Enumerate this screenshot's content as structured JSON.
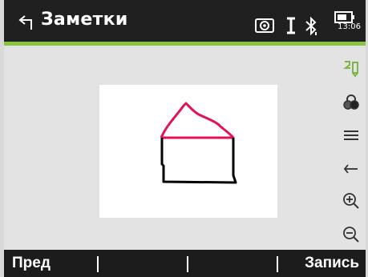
{
  "header": {
    "title": "Заметки",
    "time": "13:06",
    "accent_color": "#8ac43f",
    "status_icons": [
      "target-prism-icon",
      "tribrach-i-icon",
      "bluetooth-icon",
      "battery-icon"
    ]
  },
  "toolbar": {
    "tools": [
      "pen-icon",
      "palette-icon",
      "line-width-icon",
      "undo-icon",
      "zoom-in-icon",
      "zoom-out-icon"
    ]
  },
  "drawing": {
    "roof_color": "#e3105a",
    "walls_color": "#000000"
  },
  "softkeys": {
    "f1": "Пред",
    "f2": "",
    "f3": "",
    "f4": "Запись"
  }
}
